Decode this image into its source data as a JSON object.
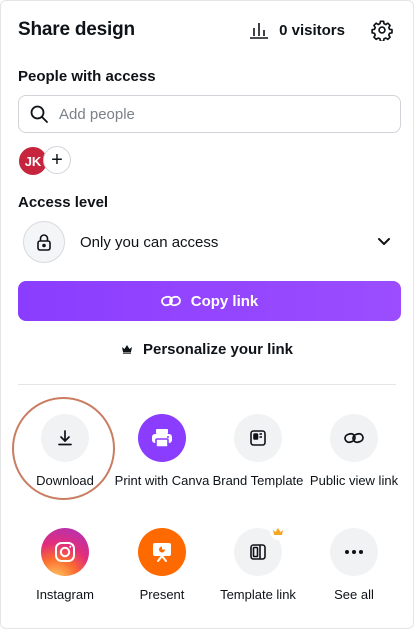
{
  "header": {
    "title": "Share design",
    "visitors": "0 visitors",
    "icons": [
      "bar-chart-icon",
      "gear-icon"
    ]
  },
  "people": {
    "label": "People with access",
    "search_placeholder": "Add people",
    "avatar_initials": "JK",
    "add_symbol": "+"
  },
  "access": {
    "label": "Access level",
    "value": "Only you can access"
  },
  "actions": {
    "copy_link": "Copy link",
    "personalize": "Personalize your link"
  },
  "share_options": [
    {
      "label": "Download",
      "icon": "download-icon"
    },
    {
      "label": "Print with Canva",
      "icon": "printer-icon"
    },
    {
      "label": "Brand Template",
      "icon": "brand-template-icon"
    },
    {
      "label": "Public view link",
      "icon": "link-icon"
    },
    {
      "label": "Instagram",
      "icon": "instagram-icon"
    },
    {
      "label": "Present",
      "icon": "present-icon"
    },
    {
      "label": "Template link",
      "icon": "template-link-icon"
    },
    {
      "label": "See all",
      "icon": "more-icon"
    }
  ],
  "colors": {
    "accent": "#8b3dff",
    "avatar": "#c7253e",
    "print": "#8b3dff",
    "present": "#ff6a00",
    "highlight_ring": "#c97d63",
    "crown": "#f5a623"
  }
}
